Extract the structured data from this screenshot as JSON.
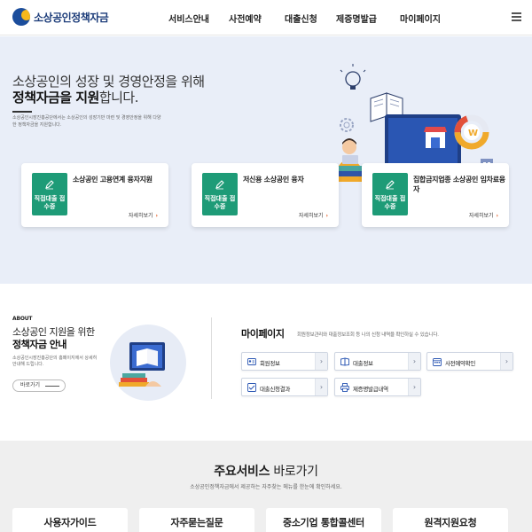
{
  "header": {
    "logo_text": "소상공인정책자금",
    "nav": [
      "서비스안내",
      "사전예약",
      "대출신청",
      "제증명발급",
      "마이페이지"
    ]
  },
  "hero": {
    "title_line1": "소상공인의 성장 및 경영안정을 위해",
    "title_line2_bold": "정책자금을 지원",
    "title_line2_rest": "합니다.",
    "description": "소상공인시장진흥공단에서는 소상공인의 성장기반 마련 및 경영안정을 위해 다양한 정책자금을 지원합니다.",
    "cards": [
      {
        "badge": "직접대출 접수중",
        "title": "소상공인 고용연계 융자지원",
        "more": "자세히보기"
      },
      {
        "badge": "직접대출 접수중",
        "title": "저신용 소상공인 융자",
        "more": "자세히보기"
      },
      {
        "badge": "직접대출 접수중",
        "title": "집합금지업종 소상공인 임차료융자",
        "more": "자세히보기"
      }
    ]
  },
  "about": {
    "label": "ABOUT",
    "title_line1": "소상공인 지원을 위한",
    "title_line2": "정책자금 안내",
    "description": "소상공인시장진흥공단의 홈페이지에서 상세히 안내해 드립니다.",
    "button": "바로가기"
  },
  "mypage": {
    "title": "마이페이지",
    "description": "회원정보관리와 대출정보조회 등 나의 신청 내역을 확인하실 수 있습니다.",
    "buttons": [
      "회원정보",
      "대출정보",
      "사전예약확인",
      "대출신청결과",
      "제증명발급내역"
    ]
  },
  "services": {
    "title_bold": "주요서비스",
    "title_rest": " 바로가기",
    "description": "소상공인정책자금에서 제공하는 자주찾는 메뉴를 한눈에 확인하세요.",
    "cards": [
      "사용자가이드",
      "자주묻는질문",
      "중소기업 통합콜센터",
      "원격지원요청"
    ]
  },
  "colors": {
    "brand_navy": "#1d3d7a",
    "badge_green": "#1e9b77",
    "hero_bg": "#e9eef8",
    "arrow_orange": "#e2561a"
  }
}
